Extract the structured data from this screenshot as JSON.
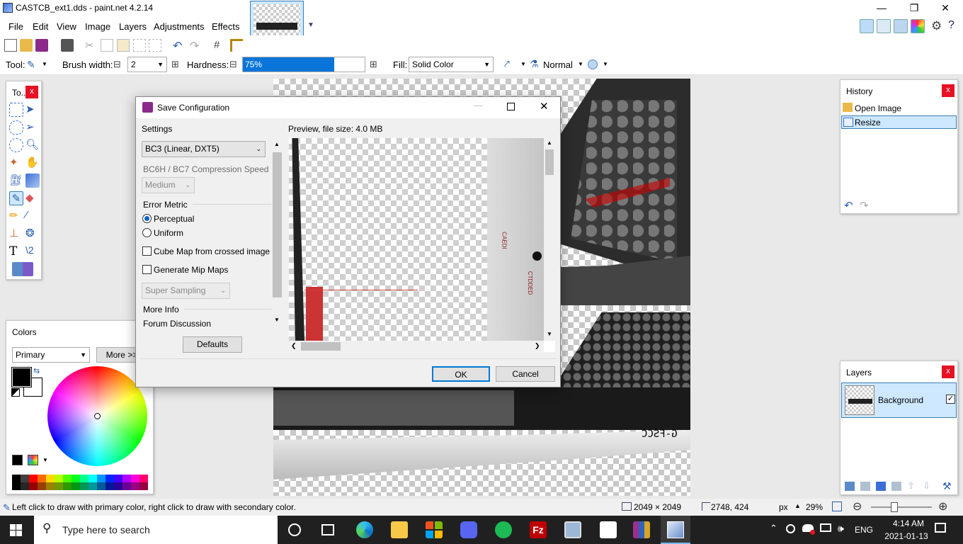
{
  "window": {
    "title": "CASTCB_ext1.dds - paint.net 4.2.14",
    "min_glyph": "—",
    "max_glyph": "❐",
    "close_glyph": "✕"
  },
  "menu": [
    "File",
    "Edit",
    "View",
    "Image",
    "Layers",
    "Adjustments",
    "Effects"
  ],
  "toolbar": {
    "tool_label": "Tool:",
    "brush_width_label": "Brush width:",
    "brush_width_value": "2",
    "hardness_label": "Hardness:",
    "hardness_value": "75%",
    "hardness_fraction": 0.75,
    "fill_label": "Fill:",
    "fill_value": "Solid Color",
    "blend_mode": "Normal",
    "minus": "⊟",
    "plus": "⊞"
  },
  "tools_panel": {
    "title": "To...",
    "close": "x"
  },
  "history_panel": {
    "title": "History",
    "close": "x",
    "items": [
      {
        "label": "Open Image",
        "selected": false
      },
      {
        "label": "Resize",
        "selected": true
      }
    ]
  },
  "layers_panel": {
    "title": "Layers",
    "close": "x",
    "layers": [
      {
        "name": "Background",
        "visible": true
      }
    ]
  },
  "colors_panel": {
    "title": "Colors",
    "mode": "Primary",
    "more_button": "More >>",
    "primary_color": "#000000",
    "secondary_color": "#ffffff",
    "palette": [
      "#000000",
      "#404040",
      "#ff0000",
      "#ff6a00",
      "#ffd800",
      "#b6ff00",
      "#4cff00",
      "#00ff21",
      "#00ff90",
      "#00ffff",
      "#0094ff",
      "#0026ff",
      "#4800ff",
      "#b200ff",
      "#ff00dc",
      "#ff006e"
    ]
  },
  "dialog": {
    "title": "Save Configuration",
    "settings_label": "Settings",
    "format": "BC3 (Linear, DXT5)",
    "compression_label": "BC6H / BC7 Compression Speed",
    "compression_value": "Medium",
    "error_metric_label": "Error Metric",
    "radio_perceptual": "Perceptual",
    "radio_uniform": "Uniform",
    "cube_map": "Cube Map from crossed image",
    "mip_maps": "Generate Mip Maps",
    "sampling": "Super Sampling",
    "more_info": "More Info",
    "forum": "Forum Discussion",
    "defaults_button": "Defaults",
    "preview_label": "Preview, file size: 4.0 MB",
    "ok_button": "OK",
    "cancel_button": "Cancel",
    "preview_text_1": "CAEDI",
    "preview_text_2": "CTDDED"
  },
  "statusbar": {
    "hint": "Left click to draw with primary color, right click to draw with secondary color.",
    "image_size": "2049 × 2049",
    "cursor_pos": "2748, 424",
    "unit": "px",
    "zoom": "29%"
  },
  "taskbar": {
    "search_placeholder": "Type here to search",
    "lang": "ENG",
    "time": "4:14 AM",
    "date": "2021-01-13"
  }
}
